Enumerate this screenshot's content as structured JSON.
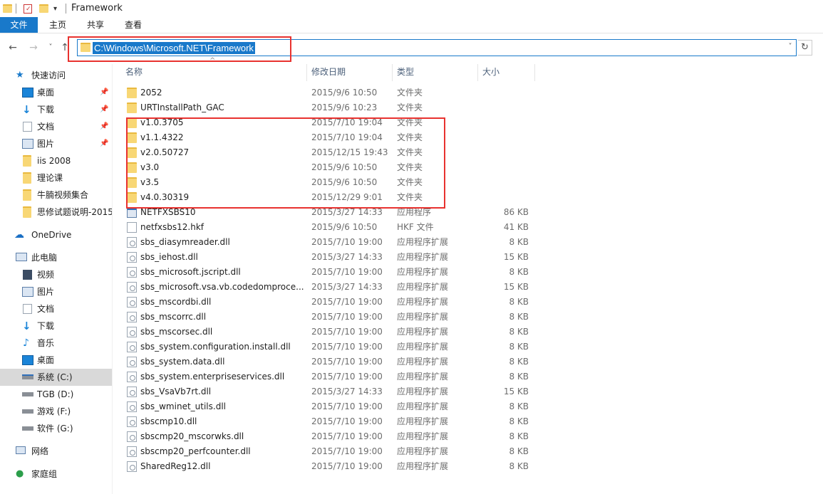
{
  "window": {
    "title": "Framework"
  },
  "ribbon": {
    "tabs": [
      {
        "label": "文件"
      },
      {
        "label": "主页"
      },
      {
        "label": "共享"
      },
      {
        "label": "查看"
      }
    ]
  },
  "address": {
    "path": "C:\\Windows\\Microsoft.NET\\Framework"
  },
  "nav": {
    "back": "←",
    "forward": "→",
    "recent": "˅",
    "up": "↑",
    "refresh": "↻",
    "dropdown": "˅"
  },
  "sidebar": {
    "quick_access": "快速访问",
    "items": [
      {
        "label": "桌面",
        "icon": "desktop-icon"
      },
      {
        "label": "下载",
        "icon": "download-icon"
      },
      {
        "label": "文档",
        "icon": "documents-icon"
      },
      {
        "label": "图片",
        "icon": "pictures-icon"
      },
      {
        "label": "iis  2008",
        "icon": "folder-icon"
      },
      {
        "label": "理论课",
        "icon": "folder-icon"
      },
      {
        "label": "牛腩视频集合",
        "icon": "folder-icon"
      },
      {
        "label": "思修试题说明-2015",
        "icon": "folder-icon"
      }
    ],
    "onedrive": "OneDrive",
    "this_pc": "此电脑",
    "pc_items": [
      {
        "label": "视频",
        "icon": "videos-icon"
      },
      {
        "label": "图片",
        "icon": "pictures-icon"
      },
      {
        "label": "文档",
        "icon": "documents-icon"
      },
      {
        "label": "下载",
        "icon": "download-icon"
      },
      {
        "label": "音乐",
        "icon": "music-icon"
      },
      {
        "label": "桌面",
        "icon": "desktop-icon"
      },
      {
        "label": "系统 (C:)",
        "icon": "drive-c-icon"
      },
      {
        "label": "TGB (D:)",
        "icon": "drive-icon"
      },
      {
        "label": "游戏 (F:)",
        "icon": "drive-icon"
      },
      {
        "label": "软件 (G:)",
        "icon": "drive-icon"
      }
    ],
    "network": "网络",
    "homegroup": "家庭组"
  },
  "columns": {
    "name": "名称",
    "date": "修改日期",
    "type": "类型",
    "size": "大小"
  },
  "files": [
    {
      "name": "2052",
      "date": "2015/9/6 10:50",
      "type": "文件夹",
      "size": "",
      "kind": "folder"
    },
    {
      "name": "URTInstallPath_GAC",
      "date": "2015/9/6 10:23",
      "type": "文件夹",
      "size": "",
      "kind": "folder"
    },
    {
      "name": "v1.0.3705",
      "date": "2015/7/10 19:04",
      "type": "文件夹",
      "size": "",
      "kind": "folder"
    },
    {
      "name": "v1.1.4322",
      "date": "2015/7/10 19:04",
      "type": "文件夹",
      "size": "",
      "kind": "folder"
    },
    {
      "name": "v2.0.50727",
      "date": "2015/12/15 19:43",
      "type": "文件夹",
      "size": "",
      "kind": "folder"
    },
    {
      "name": "v3.0",
      "date": "2015/9/6 10:50",
      "type": "文件夹",
      "size": "",
      "kind": "folder"
    },
    {
      "name": "v3.5",
      "date": "2015/9/6 10:50",
      "type": "文件夹",
      "size": "",
      "kind": "folder"
    },
    {
      "name": "v4.0.30319",
      "date": "2015/12/29 9:01",
      "type": "文件夹",
      "size": "",
      "kind": "folder"
    },
    {
      "name": "NETFXSBS10",
      "date": "2015/3/27 14:33",
      "type": "应用程序",
      "size": "86 KB",
      "kind": "exe"
    },
    {
      "name": "netfxsbs12.hkf",
      "date": "2015/9/6 10:50",
      "type": "HKF 文件",
      "size": "41 KB",
      "kind": "file"
    },
    {
      "name": "sbs_diasymreader.dll",
      "date": "2015/7/10 19:00",
      "type": "应用程序扩展",
      "size": "8 KB",
      "kind": "dll"
    },
    {
      "name": "sbs_iehost.dll",
      "date": "2015/3/27 14:33",
      "type": "应用程序扩展",
      "size": "15 KB",
      "kind": "dll"
    },
    {
      "name": "sbs_microsoft.jscript.dll",
      "date": "2015/7/10 19:00",
      "type": "应用程序扩展",
      "size": "8 KB",
      "kind": "dll"
    },
    {
      "name": "sbs_microsoft.vsa.vb.codedomproce...",
      "date": "2015/3/27 14:33",
      "type": "应用程序扩展",
      "size": "15 KB",
      "kind": "dll"
    },
    {
      "name": "sbs_mscordbi.dll",
      "date": "2015/7/10 19:00",
      "type": "应用程序扩展",
      "size": "8 KB",
      "kind": "dll"
    },
    {
      "name": "sbs_mscorrc.dll",
      "date": "2015/7/10 19:00",
      "type": "应用程序扩展",
      "size": "8 KB",
      "kind": "dll"
    },
    {
      "name": "sbs_mscorsec.dll",
      "date": "2015/7/10 19:00",
      "type": "应用程序扩展",
      "size": "8 KB",
      "kind": "dll"
    },
    {
      "name": "sbs_system.configuration.install.dll",
      "date": "2015/7/10 19:00",
      "type": "应用程序扩展",
      "size": "8 KB",
      "kind": "dll"
    },
    {
      "name": "sbs_system.data.dll",
      "date": "2015/7/10 19:00",
      "type": "应用程序扩展",
      "size": "8 KB",
      "kind": "dll"
    },
    {
      "name": "sbs_system.enterpriseservices.dll",
      "date": "2015/7/10 19:00",
      "type": "应用程序扩展",
      "size": "8 KB",
      "kind": "dll"
    },
    {
      "name": "sbs_VsaVb7rt.dll",
      "date": "2015/3/27 14:33",
      "type": "应用程序扩展",
      "size": "15 KB",
      "kind": "dll"
    },
    {
      "name": "sbs_wminet_utils.dll",
      "date": "2015/7/10 19:00",
      "type": "应用程序扩展",
      "size": "8 KB",
      "kind": "dll"
    },
    {
      "name": "sbscmp10.dll",
      "date": "2015/7/10 19:00",
      "type": "应用程序扩展",
      "size": "8 KB",
      "kind": "dll"
    },
    {
      "name": "sbscmp20_mscorwks.dll",
      "date": "2015/7/10 19:00",
      "type": "应用程序扩展",
      "size": "8 KB",
      "kind": "dll"
    },
    {
      "name": "sbscmp20_perfcounter.dll",
      "date": "2015/7/10 19:00",
      "type": "应用程序扩展",
      "size": "8 KB",
      "kind": "dll"
    },
    {
      "name": "SharedReg12.dll",
      "date": "2015/7/10 19:00",
      "type": "应用程序扩展",
      "size": "8 KB",
      "kind": "dll"
    }
  ],
  "colors": {
    "accent": "#1979ca",
    "highlight_red": "#e8322f",
    "folder": "#f8d775"
  }
}
